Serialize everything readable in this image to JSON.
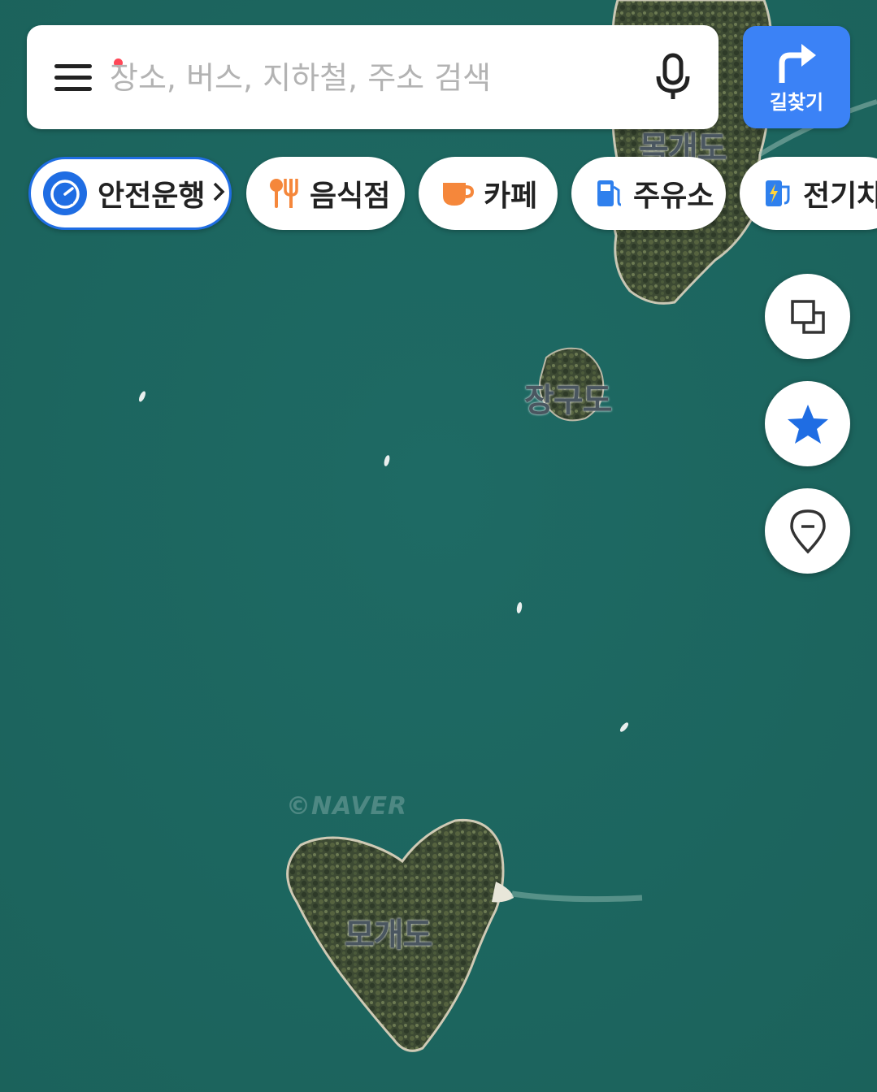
{
  "search": {
    "placeholder": "장소, 버스, 지하철, 주소 검색",
    "menu_icon": "hamburger-menu-icon",
    "mic_icon": "microphone-icon",
    "notification_dot_color": "#ff4757"
  },
  "directions": {
    "label": "길찾기",
    "icon": "turn-right-arrow-icon",
    "color": "#3b82f6"
  },
  "chips": [
    {
      "label": "안전운행",
      "icon": "speedometer-icon"
    },
    {
      "label": "음식점",
      "icon": "fork-knife-icon"
    },
    {
      "label": "카페",
      "icon": "coffee-cup-icon"
    },
    {
      "label": "주유소",
      "icon": "gas-pump-icon"
    },
    {
      "label": "전기차",
      "icon": "ev-charger-icon"
    }
  ],
  "map": {
    "islands": [
      {
        "name": "목개도"
      },
      {
        "name": "장구도"
      },
      {
        "name": "모개도"
      }
    ],
    "watermark": "©NAVER",
    "water_color": "#1f6a63"
  },
  "side_buttons": [
    {
      "icon": "layers-icon"
    },
    {
      "icon": "star-favorite-icon"
    },
    {
      "icon": "location-pin-icon"
    }
  ]
}
